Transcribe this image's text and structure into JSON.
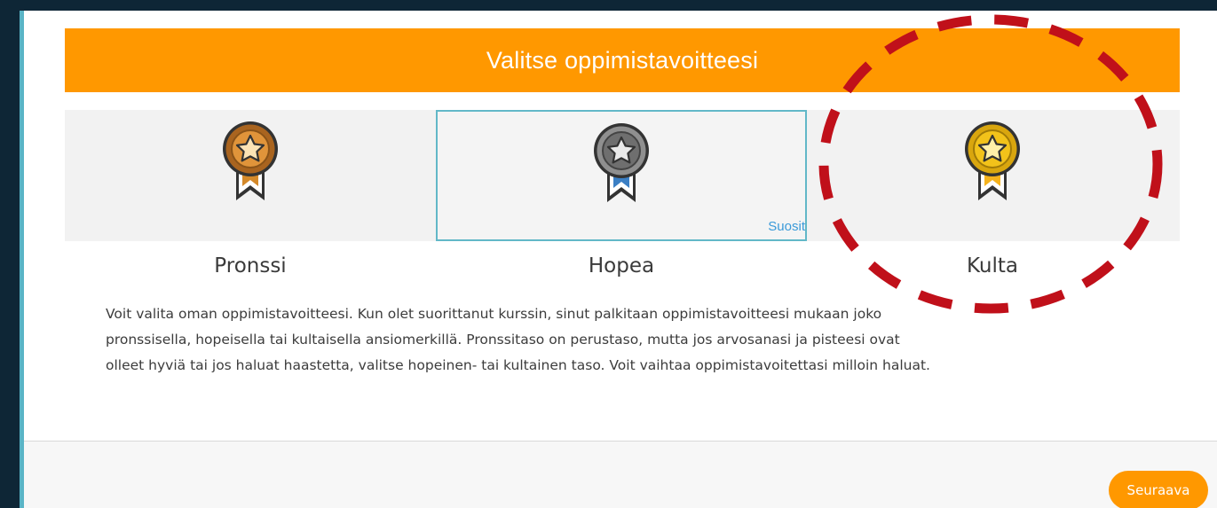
{
  "dialog": {
    "title": "Valitse oppimistavoitteesi",
    "recommended_tag": "Suosit",
    "next_label": "Seuraava"
  },
  "goals": [
    {
      "id": "bronze",
      "label": "Pronssi",
      "medal_icon": "bronze-medal-icon",
      "color": "#d4892a",
      "selected": false
    },
    {
      "id": "silver",
      "label": "Hopea",
      "medal_icon": "silver-medal-icon",
      "color": "#7a7a7a",
      "selected": true,
      "recommended": true
    },
    {
      "id": "gold",
      "label": "Kulta",
      "medal_icon": "gold-medal-icon",
      "color": "#f2c21a",
      "selected": false
    }
  ],
  "description_lines": [
    "Voit valita oman oppimistavoitteesi. Kun olet suorittanut kurssin, sinut palkitaan oppimistavoitteesi mukaan joko",
    "pronssisella, hopeisella tai kultaisella ansiomerkillä. Pronssitaso on perustaso, mutta jos arvosanasi ja pisteesi ovat",
    "olleet hyviä tai jos haluat haastetta, valitse hopeinen- tai kultainen taso. Voit vaihtaa oppimistavoitettasi milloin haluat."
  ],
  "colors": {
    "accent": "#ff9800",
    "selection_border": "#62b8c8",
    "annotation": "#c0101a"
  }
}
